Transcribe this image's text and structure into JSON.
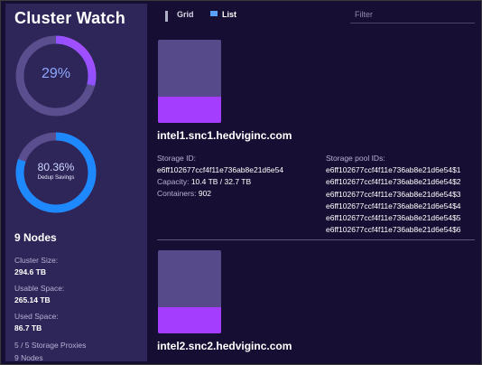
{
  "app": {
    "title": "Cluster Watch"
  },
  "colors": {
    "accent": "#a53dff",
    "ring_blue": "#1e88ff",
    "sidebar": "#2e2558",
    "background": "#170f33"
  },
  "summary": {
    "usage_ring": {
      "label": "29%",
      "fraction": 0.29
    },
    "dedup_ring": {
      "label": "80.36%",
      "sub_label": "Dedup Savings",
      "fraction": 0.8036
    },
    "nodes_title": "9 Nodes",
    "stats": [
      {
        "label": "Cluster Size:",
        "value": "294.6 TB"
      },
      {
        "label": "Usable Space:",
        "value": "265.14 TB"
      },
      {
        "label": "Used Space:",
        "value": "86.7 TB"
      }
    ],
    "proxies": "5 / 5 Storage Proxies",
    "nodes_count": "9 Nodes"
  },
  "toolbar": {
    "grid_label": "Grid",
    "grid_icon": "grid-icon",
    "list_label": "List",
    "list_icon": "list-icon",
    "active_view": "List",
    "filter_placeholder": "Filter",
    "filter_value": ""
  },
  "nodes": [
    {
      "hostname": "intel1.snc1.hedviginc.com",
      "used_fraction": 0.32,
      "storage_id_label": "Storage ID:",
      "storage_id": "e6ff102677ccf4f11e736ab8e21d6e54",
      "capacity_label": "Capacity:",
      "capacity": "10.4 TB / 32.7 TB",
      "containers_label": "Containers:",
      "containers": "902",
      "pool_ids_label": "Storage pool IDs:",
      "pool_ids": [
        "e6ff102677ccf4f11e736ab8e21d6e54$1",
        "e6ff102677ccf4f11e736ab8e21d6e54$2",
        "e6ff102677ccf4f11e736ab8e21d6e54$3",
        "e6ff102677ccf4f11e736ab8e21d6e54$4",
        "e6ff102677ccf4f11e736ab8e21d6e54$5",
        "e6ff102677ccf4f11e736ab8e21d6e54$6"
      ]
    },
    {
      "hostname": "intel2.snc2.hedviginc.com",
      "used_fraction": 0.32
    }
  ]
}
